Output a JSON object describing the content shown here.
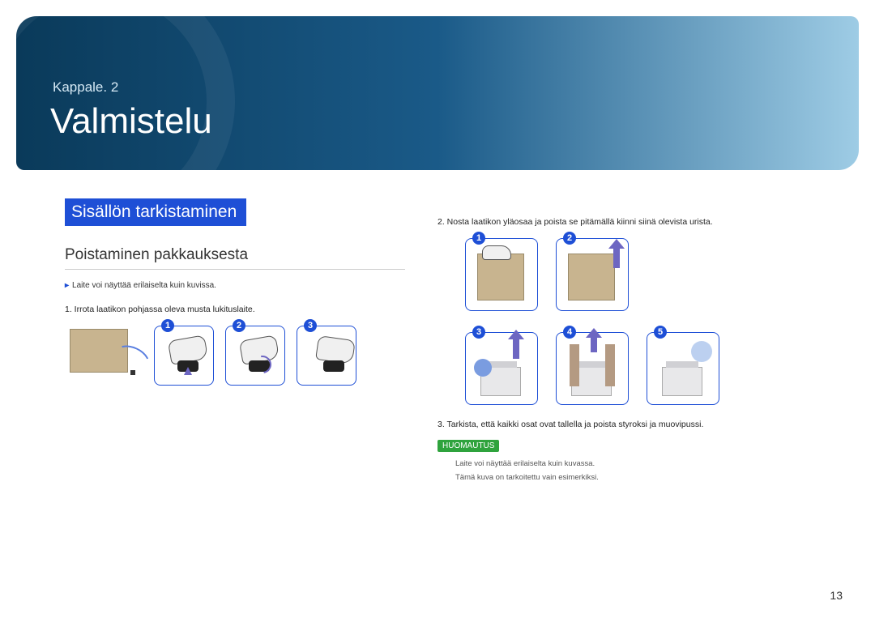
{
  "header": {
    "chapter_label": "Kappale. 2",
    "title": "Valmistelu"
  },
  "section": {
    "title": "Sisällön tarkistaminen",
    "subsection": "Poistaminen pakkauksesta"
  },
  "left": {
    "bullet": "Laite voi näyttää erilaiselta kuin kuvissa.",
    "step1": "1.  Irrota laatikon pohjassa oleva musta lukituslaite.",
    "fig_nums": [
      "1",
      "2",
      "3"
    ]
  },
  "right": {
    "step2": "2.  Nosta laatikon yläosaa ja poista se pitämällä kiinni siinä olevista urista.",
    "row1_nums": [
      "1",
      "2"
    ],
    "row2_nums": [
      "3",
      "4",
      "5"
    ],
    "step3": "3.  Tarkista, että kaikki osat ovat tallella ja poista styroksi ja muovipussi.",
    "note_badge": "HUOMAUTUS",
    "note_line1": "Laite voi näyttää erilaiselta kuin kuvassa.",
    "note_line2": "Tämä kuva on tarkoitettu vain esimerkiksi."
  },
  "page_number": "13"
}
